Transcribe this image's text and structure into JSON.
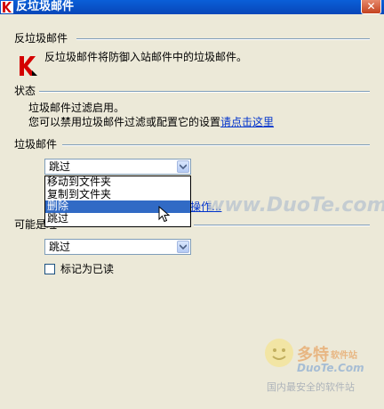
{
  "window": {
    "title": "反垃圾邮件",
    "close_glyph": "✕"
  },
  "antispam": {
    "heading": "反垃圾邮件",
    "description": "反垃圾邮件将防御入站邮件中的垃圾邮件。"
  },
  "status": {
    "heading": "状态",
    "line1": "垃圾邮件过滤启用。",
    "line2_prefix": "您可以禁用垃圾邮件过滤或配置它的设置",
    "line2_link": "请点击这里"
  },
  "spam": {
    "heading": "垃圾邮件",
    "action_selected": "跳过",
    "options": [
      "移动到文件夹",
      "复制到文件夹",
      "删除",
      "跳过"
    ],
    "highlighted_option": "删除",
    "hidden_link_partial": "操作..."
  },
  "possible_spam": {
    "heading_partial": "可能是垃",
    "action_selected": "跳过",
    "mark_read_label": "标记为已读",
    "mark_read_checked": false
  },
  "watermarks": {
    "overlay": "www.DuoTe.com",
    "brand": "多特",
    "brand_suffix": "软件站",
    "brand_url": "DuoTe.Com",
    "tagline": "国内最安全的软件站"
  },
  "colors": {
    "titlebar": "#0a5fd8",
    "background": "#ece9d8",
    "selection": "#316ac5",
    "link": "#0033cc"
  }
}
